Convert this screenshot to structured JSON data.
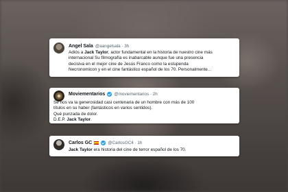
{
  "tweets": [
    {
      "name": "Angel Sala",
      "handle": "@aangelsala · 3h",
      "lines": [
        [
          "Adiós a ",
          "Jack Taylor",
          ", actor fundamental en la historia de nuestro cine más"
        ],
        [
          "internacional Su filmografía es inabarcable aunque fue una presencia",
          "",
          ""
        ],
        [
          "decisiva en el mejor cine de Jesús Franco como la estupenda",
          "",
          ""
        ],
        [
          "Necronomicon y en el cine fantástico español de los 70. Personalmente...",
          "",
          ""
        ]
      ]
    },
    {
      "name": "Moviementarios",
      "handle": "@moviementarios · 2h",
      "lines": [
        [
          "Se nos va la generosidad casi centenaria de un hombre con más de 100",
          "",
          ""
        ],
        [
          "títulos en su haber (fantásticos en varios sentidos).",
          "",
          ""
        ],
        [
          "Qué punzada de dolor.",
          "",
          ""
        ],
        [
          "D.E.P. ",
          "Jack Taylor",
          "."
        ]
      ]
    },
    {
      "name": "Carlos GC",
      "handle": "@CarlosGC4 · 1h",
      "lines": [
        [
          "",
          "Jack Taylor",
          " era historia del cine de terror español de los 70."
        ]
      ]
    }
  ],
  "icons": {
    "verified": "verified-badge-icon",
    "flag": "spain-flag-icon"
  },
  "colors": {
    "accent": "#1d9bf0",
    "text": "#0f1419",
    "secondary": "#536471"
  }
}
